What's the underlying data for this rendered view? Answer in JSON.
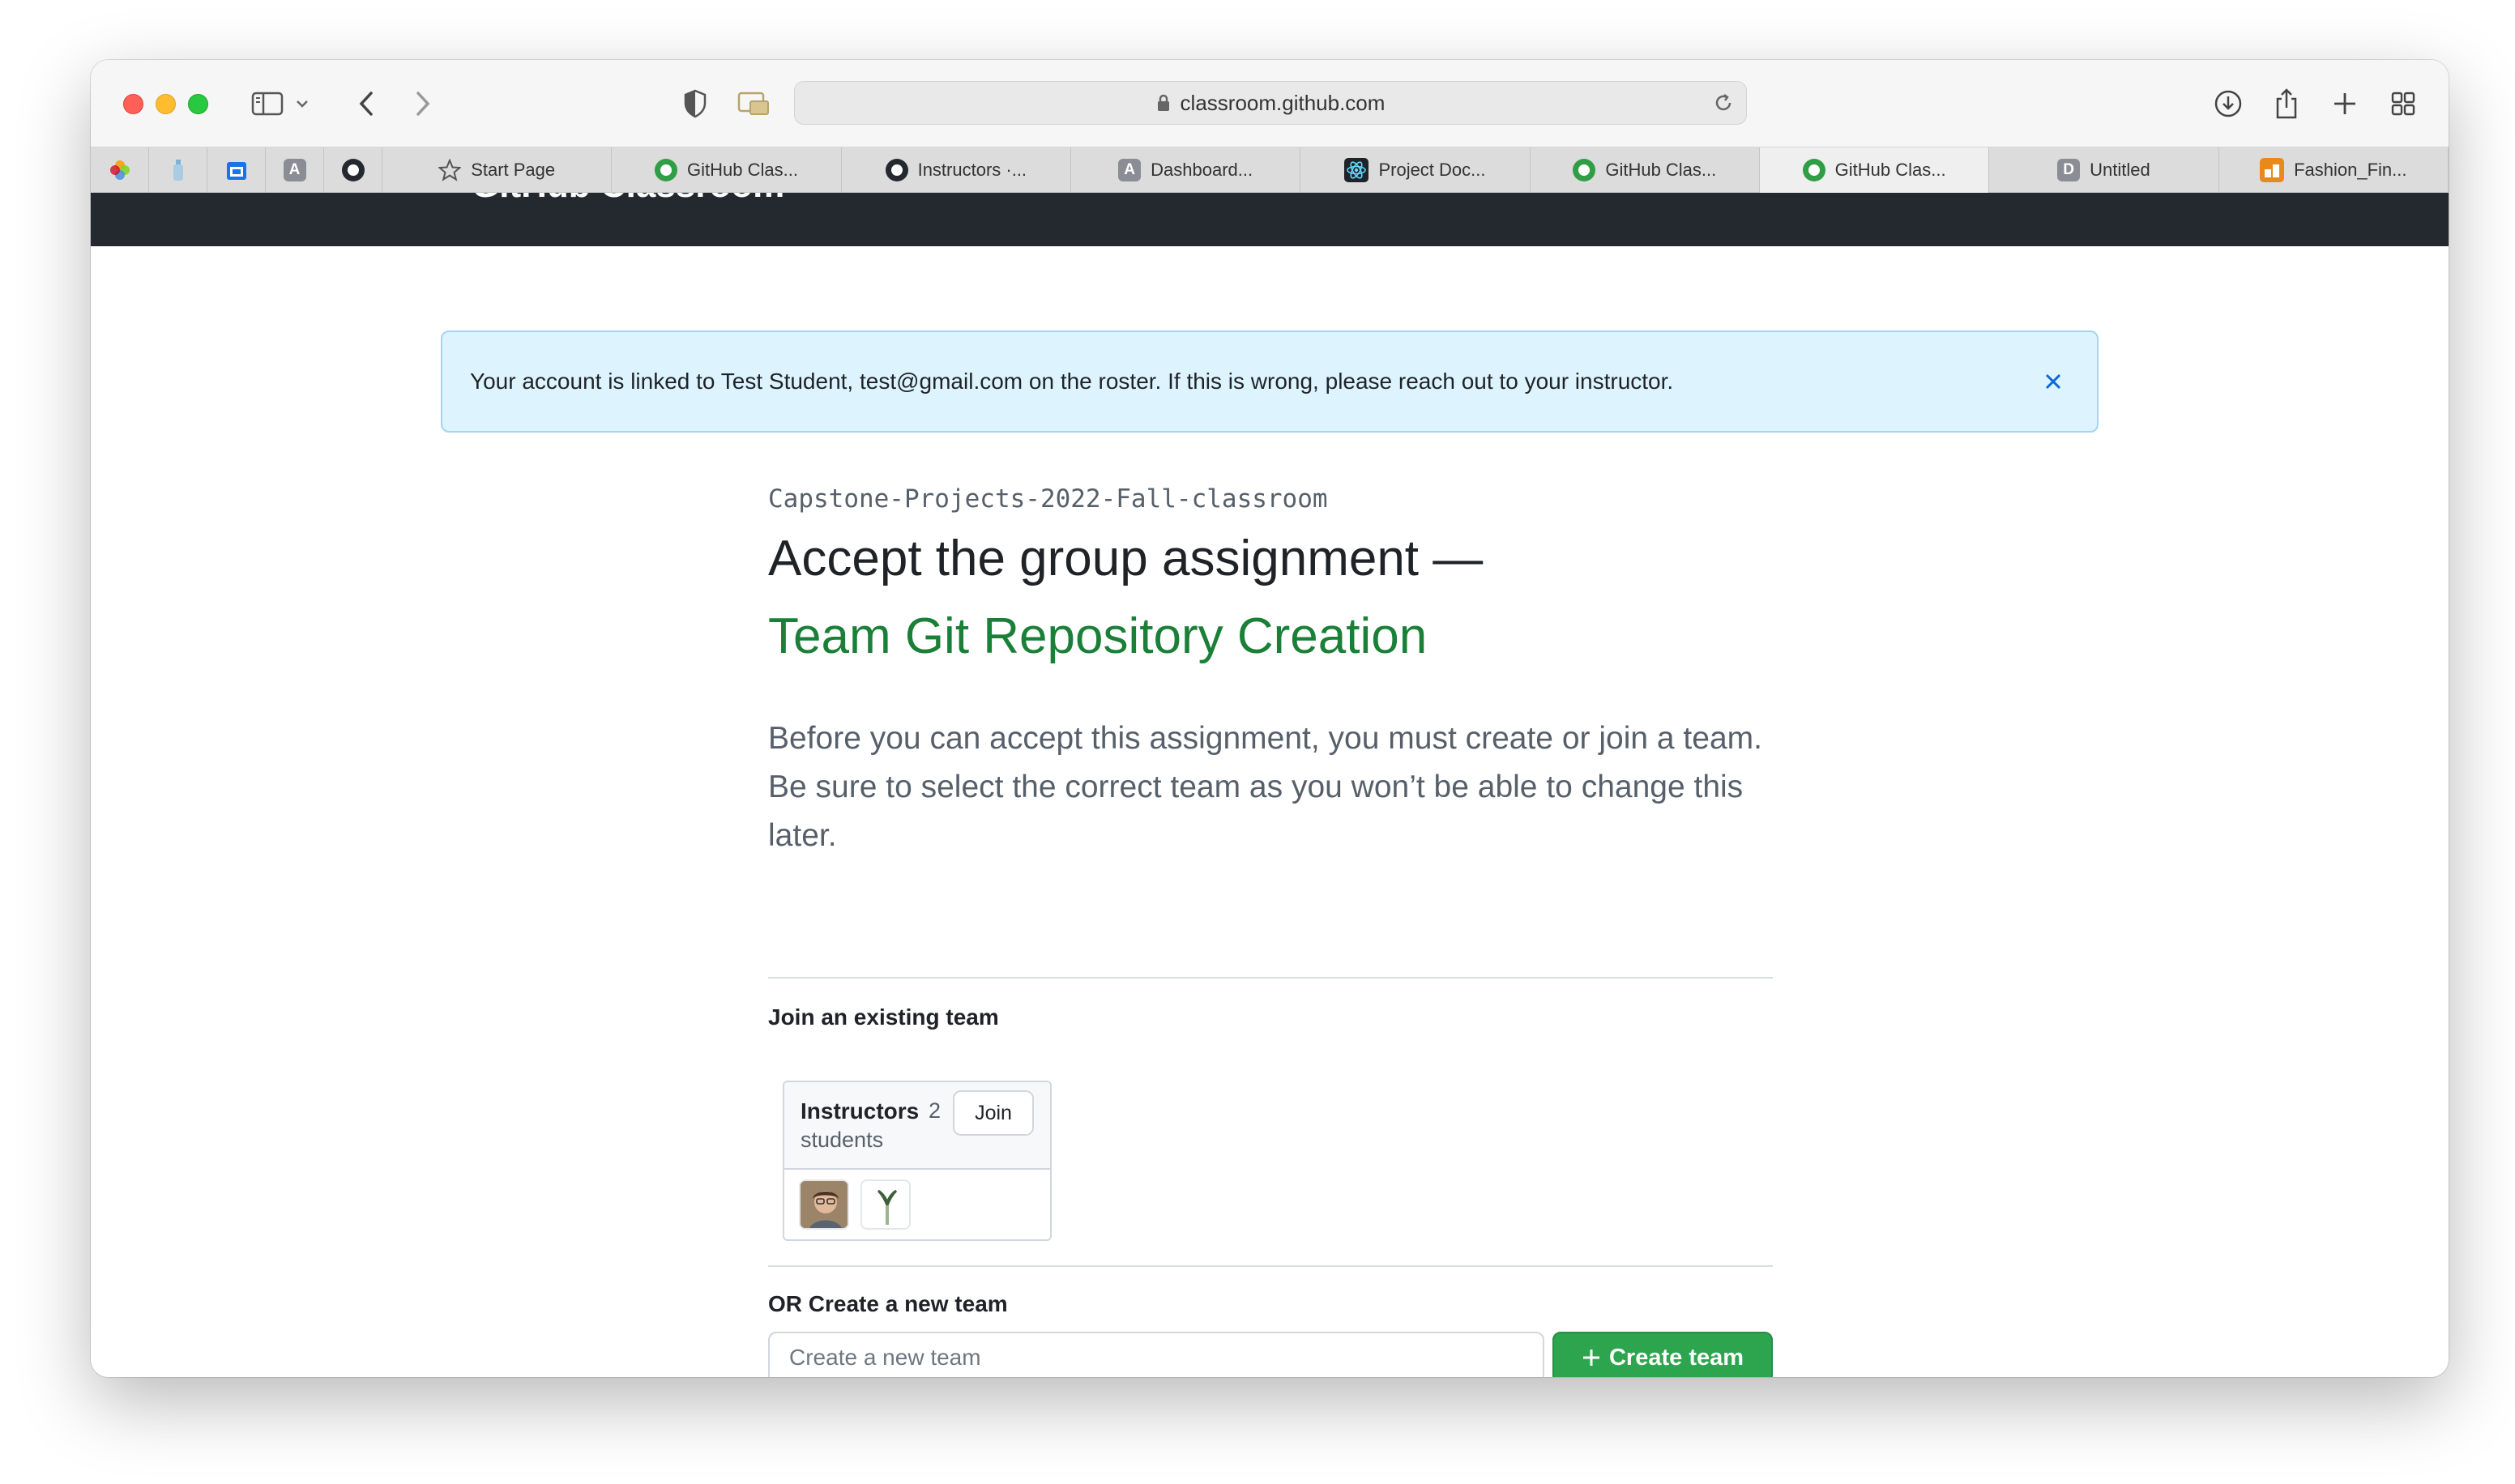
{
  "browser": {
    "url": "classroom.github.com",
    "tabs": [
      {
        "title": "Start Page",
        "icon": "star-icon"
      },
      {
        "title": "GitHub Clas...",
        "icon": "github-classroom-icon"
      },
      {
        "title": "Instructors ·...",
        "icon": "github-icon"
      },
      {
        "title": "Dashboard...",
        "icon": "a-icon",
        "letter": "A"
      },
      {
        "title": "Project Doc...",
        "icon": "react-icon"
      },
      {
        "title": "GitHub Clas...",
        "icon": "github-classroom-icon"
      },
      {
        "title": "GitHub Clas...",
        "icon": "github-classroom-icon",
        "active": true
      },
      {
        "title": "Untitled",
        "icon": "d-icon",
        "letter": "D"
      },
      {
        "title": "Fashion_Fin...",
        "icon": "fashion-app-icon"
      }
    ],
    "pinned_tabs": [
      "photos-app-icon",
      "bottle-icon",
      "calendar-icon",
      "a-icon",
      "github-icon"
    ],
    "pinned_letter": "A"
  },
  "header": {
    "title": "GitHub Classroom"
  },
  "flash": {
    "message": "Your account is linked to Test Student, test@gmail.com on the roster. If this is wrong, please reach out to your instructor."
  },
  "assignment": {
    "organization": "Capstone-Projects-2022-Fall-classroom",
    "heading": "Accept the group assignment —",
    "name": "Team Git Repository Creation",
    "lead": "Before you can accept this assignment, you must create or join a team. Be sure to select the correct team as you won’t be able to change this later."
  },
  "join": {
    "heading": "Join an existing team",
    "teams": [
      {
        "name": "Instructors",
        "count": "2",
        "count_label": "students",
        "button": "Join"
      }
    ]
  },
  "create": {
    "heading": "OR Create a new team",
    "placeholder": "Create a new team",
    "button": "Create team"
  },
  "colors": {
    "accent_green": "#2da44e",
    "assignment_green": "#1a7f37",
    "flash_bg": "#ddf4ff",
    "header_bg": "#24292f"
  }
}
